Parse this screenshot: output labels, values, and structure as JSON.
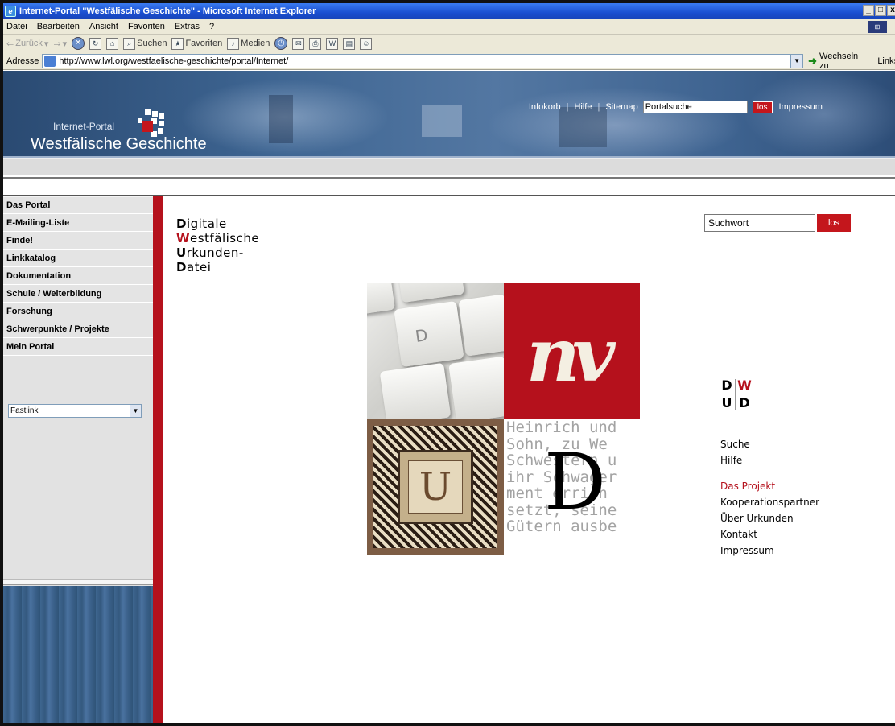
{
  "window": {
    "title": "Internet-Portal \"Westfälische Geschichte\" - Microsoft Internet Explorer",
    "controls": [
      "_",
      "□",
      "x"
    ]
  },
  "menubar": {
    "items": [
      "Datei",
      "Bearbeiten",
      "Ansicht",
      "Favoriten",
      "Extras",
      "?"
    ]
  },
  "toolbar": {
    "back": "Zurück",
    "search": "Suchen",
    "favorites": "Favoriten",
    "media": "Medien"
  },
  "addressbar": {
    "label": "Adresse",
    "url": "http://www.lwl.org/westfaelische-geschichte/portal/Internet/",
    "go": "Wechseln zu",
    "links": "Links"
  },
  "banner": {
    "subtitle": "Internet-Portal",
    "title": "Westfälische Geschichte",
    "nav": [
      "Infokorb",
      "Hilfe",
      "Sitemap"
    ],
    "search_value": "Portalsuche",
    "search_button": "los",
    "impressum": "Impressum"
  },
  "leftnav": {
    "items": [
      "Das Portal",
      "E-Mailing-Liste",
      "Finde!",
      "Linkkatalog",
      "Dokumentation",
      "Schule / Weiterbildung",
      "Forschung",
      "Schwerpunkte / Projekte",
      "Mein Portal"
    ],
    "fastlink": "Fastlink"
  },
  "content": {
    "title_lines": [
      {
        "cap": "D",
        "rest": "igitale"
      },
      {
        "cap": "W",
        "rest": "estfälische"
      },
      {
        "cap": "U",
        "rest": "rkunden-"
      },
      {
        "cap": "D",
        "rest": "atei"
      }
    ],
    "search_value": "Suchwort",
    "search_button": "los",
    "collage": {
      "key_letter": "D",
      "red_glyph": "nv",
      "ornament_letter": "U",
      "big_letter": "D",
      "text_lines": [
        "Heinrich und",
        "Sohn, zu We",
        "Schwestern u",
        "ihr Schwager",
        "ment errich",
        "setzt, seine",
        "Gütern ausbe"
      ]
    },
    "logo": {
      "tl": "D",
      "tr": "W",
      "bl": "U",
      "br": "D"
    },
    "rightnav": {
      "group1": [
        "Suche",
        "Hilfe"
      ],
      "group2": [
        "Das Projekt",
        "Kooperationspartner",
        "Über Urkunden",
        "Kontakt",
        "Impressum"
      ],
      "active": "Das Projekt"
    }
  },
  "colors": {
    "accent_red": "#b5111c",
    "banner_blue": "#3e6592",
    "nav_gray": "#e2e2e2"
  }
}
